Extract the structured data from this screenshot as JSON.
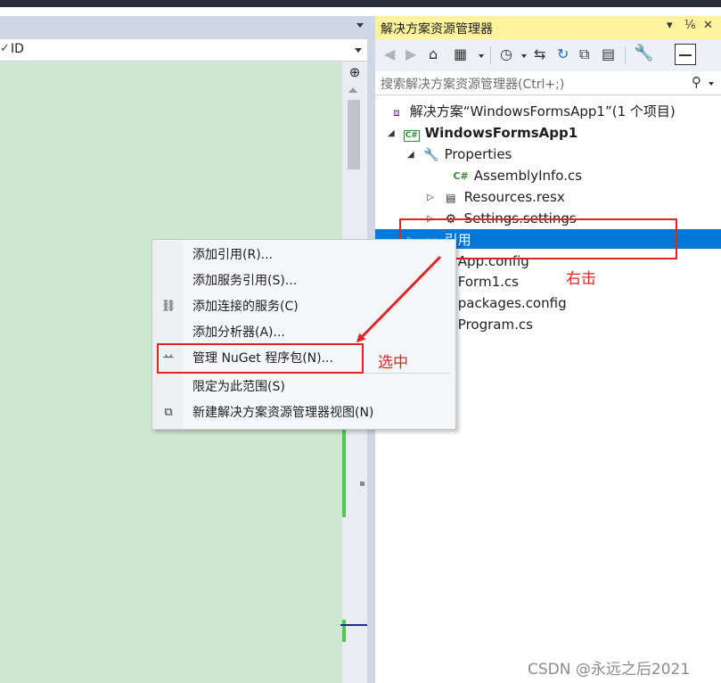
{
  "editor": {
    "member_combo_value": "ID",
    "split_glyph": "➕"
  },
  "solution_explorer": {
    "title": "解决方案资源管理器",
    "title_controls": {
      "dropdown": "▾",
      "pin": "⅙",
      "close": "✕"
    },
    "search_placeholder": "搜索解决方案资源管理器(Ctrl+;)",
    "tree": {
      "solution": "解决方案“WindowsFormsApp1”(1 个项目)",
      "project": "WindowsFormsApp1",
      "properties": "Properties",
      "assemblyinfo": "AssemblyInfo.cs",
      "resources": "Resources.resx",
      "settings": "Settings.settings",
      "references": "引用",
      "appconfig": "App.config",
      "form1": "Form1.cs",
      "packages": "packages.config",
      "program": "Program.cs"
    }
  },
  "context_menu": {
    "items": [
      {
        "label": "添加引用(R)...",
        "icon": ""
      },
      {
        "label": "添加服务引用(S)...",
        "icon": ""
      },
      {
        "label": "添加连接的服务(C)",
        "icon": "connected-service-icon"
      },
      {
        "label": "添加分析器(A)...",
        "icon": ""
      },
      {
        "label": "管理 NuGet 程序包(N)...",
        "icon": "nuget-package-icon"
      },
      {
        "label": "限定为此范围(S)",
        "icon": ""
      },
      {
        "label": "新建解决方案资源管理器视图(N)",
        "icon": "new-view-icon"
      }
    ]
  },
  "annotations": {
    "right_click": "右击",
    "selected": "选中"
  },
  "watermark": "CSDN @永远之后2021",
  "colors": {
    "selection": "#0078d7",
    "annotation": "#e02424",
    "editor_bg": "#cde8cf",
    "title_bg": "#fff29d"
  }
}
